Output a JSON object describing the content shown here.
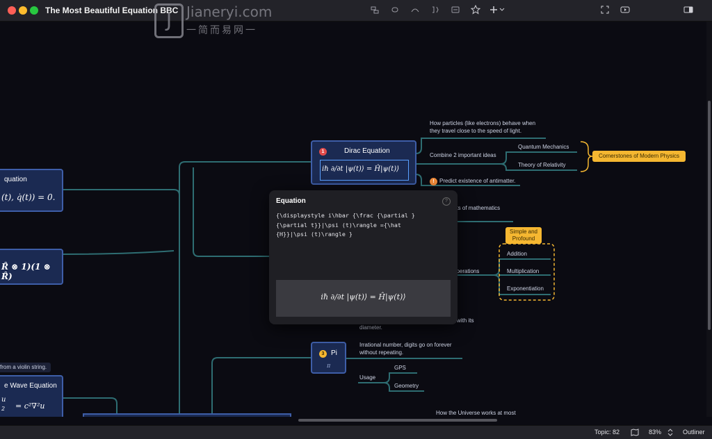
{
  "window": {
    "title": "The Most Beautiful Equation BBC"
  },
  "toolbar": {
    "icons": [
      "subtopic-icon",
      "relationship-icon",
      "boundary-icon",
      "summary-icon",
      "note-icon",
      "star-icon",
      "add-icon"
    ],
    "right_icons": [
      "fullscreen-icon",
      "present-icon",
      "sidebar-icon"
    ]
  },
  "watermark": {
    "logo": "J",
    "main": "Jianeryi.com",
    "sub": "一简而易网一"
  },
  "left_nodes": {
    "node1_title": "quation",
    "node1_math": "(t), q̇(t)) = 0.",
    "node2_math": "R̂ ⊗ 1)(1 ⊗ R̂)",
    "violin_label": "from a violin string.",
    "wave_title": "e Wave Equation",
    "wave_math_top": "u",
    "wave_math": "= c²∇²u",
    "wave_math_left": "2"
  },
  "dirac": {
    "badge": "1",
    "title": "Dirac Equation",
    "math": "iℏ ∂/∂t |ψ(t)⟩ = Ĥ|ψ(t)⟩"
  },
  "dirac_branches": {
    "particles": [
      "How particles (like electrons) behave when",
      "they travel close to the speed of light."
    ],
    "combine": "Combine 2 important ideas",
    "qm": "Quantum Mechanics",
    "relativity": "Theory of Relativity",
    "cornerstones": "Cornerstones of Modern Physics",
    "predict_badge": "!",
    "predict": "Predict existence of antimatter."
  },
  "euler_branches": {
    "elements": "nts of mathematics",
    "operations": "operations",
    "simple_profound": [
      "Simple and",
      "Profound"
    ],
    "addition": "Addition",
    "multiplication": "Multiplication",
    "exponentiation": "Exponentiation",
    "with_its": "with its",
    "diameter": "diameter."
  },
  "pi": {
    "badge": "3",
    "title": "Pi",
    "symbol": "π",
    "irrational": [
      "Irrational number, digits go on forever",
      "without repeating."
    ],
    "usage": "Usage",
    "gps": "GPS",
    "geometry": "Geometry",
    "universe": "How the Universe works at most"
  },
  "popup": {
    "title": "Equation",
    "help": "?",
    "code": "{\\displaystyle i\\hbar {\\frac {\\partial }\n{\\partial t}}|\\psi (t)\\rangle ={\\hat\n{H}}|\\psi (t)\\rangle }",
    "preview": "iℏ ∂/∂t |ψ(t)⟩ = Ĥ|ψ(t)⟩"
  },
  "status": {
    "topic_count": "Topic: 82",
    "zoom": "83%",
    "outliner": "Outliner"
  },
  "colors": {
    "node_fill": "#1b2a52",
    "node_border": "#3e5ea8",
    "branch_line": "#2e6d72",
    "accent_yellow": "#f5b731",
    "badge_red": "#e24b4b",
    "badge_orange": "#f08b3a"
  }
}
